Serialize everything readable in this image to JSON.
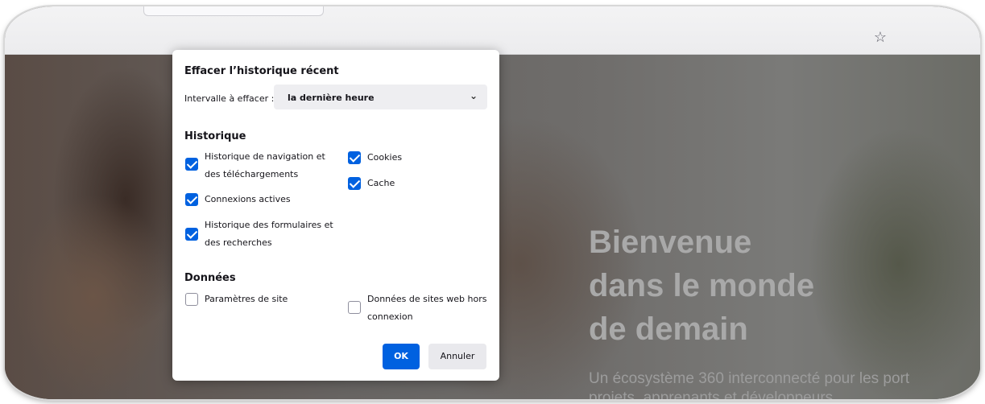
{
  "browser": {
    "bookmark_icon": "star-icon"
  },
  "page": {
    "hero_line1": "Bienvenue",
    "hero_line2": "dans le monde",
    "hero_line3": "de demain",
    "subtitle_line1": "Un écosystème 360 interconnecté pour les port",
    "subtitle_line2": "projets, apprenants et développeurs."
  },
  "dialog": {
    "title": "Effacer l’historique récent",
    "interval_label": "Intervalle à effacer :",
    "interval_value": "la dernière heure",
    "history_heading": "Historique",
    "history_items": [
      {
        "label": "Historique de navigation et des téléchargements",
        "checked": true
      },
      {
        "label": "Connexions actives",
        "checked": true
      },
      {
        "label": "Historique des formulaires et des recherches",
        "checked": true
      },
      {
        "label": "Cookies",
        "checked": true
      },
      {
        "label": "Cache",
        "checked": true
      }
    ],
    "data_heading": "Données",
    "data_items": [
      {
        "label": "Paramètres de site",
        "checked": false
      },
      {
        "label": "Données de sites web hors connexion",
        "checked": false
      }
    ],
    "ok_label": "OK",
    "cancel_label": "Annuler"
  }
}
